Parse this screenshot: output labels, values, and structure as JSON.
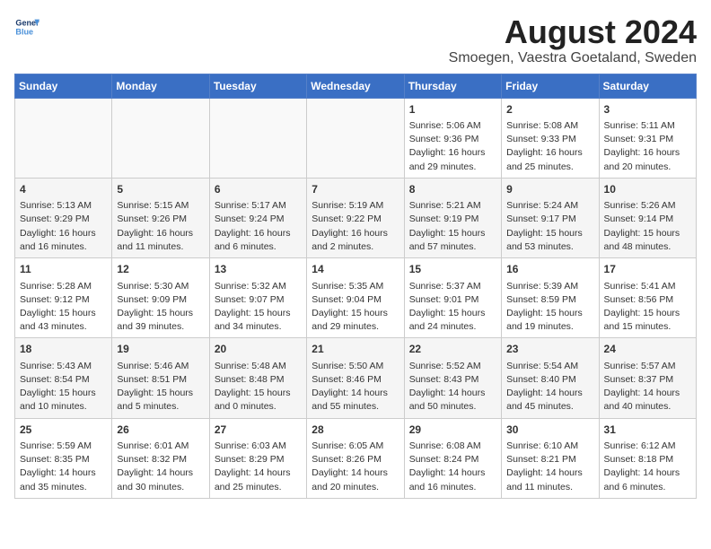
{
  "logo": {
    "line1": "General",
    "line2": "Blue"
  },
  "title": "August 2024",
  "subtitle": "Smoegen, Vaestra Goetaland, Sweden",
  "days_of_week": [
    "Sunday",
    "Monday",
    "Tuesday",
    "Wednesday",
    "Thursday",
    "Friday",
    "Saturday"
  ],
  "weeks": [
    [
      {
        "day": "",
        "info": ""
      },
      {
        "day": "",
        "info": ""
      },
      {
        "day": "",
        "info": ""
      },
      {
        "day": "",
        "info": ""
      },
      {
        "day": "1",
        "info": "Sunrise: 5:06 AM\nSunset: 9:36 PM\nDaylight: 16 hours\nand 29 minutes."
      },
      {
        "day": "2",
        "info": "Sunrise: 5:08 AM\nSunset: 9:33 PM\nDaylight: 16 hours\nand 25 minutes."
      },
      {
        "day": "3",
        "info": "Sunrise: 5:11 AM\nSunset: 9:31 PM\nDaylight: 16 hours\nand 20 minutes."
      }
    ],
    [
      {
        "day": "4",
        "info": "Sunrise: 5:13 AM\nSunset: 9:29 PM\nDaylight: 16 hours\nand 16 minutes."
      },
      {
        "day": "5",
        "info": "Sunrise: 5:15 AM\nSunset: 9:26 PM\nDaylight: 16 hours\nand 11 minutes."
      },
      {
        "day": "6",
        "info": "Sunrise: 5:17 AM\nSunset: 9:24 PM\nDaylight: 16 hours\nand 6 minutes."
      },
      {
        "day": "7",
        "info": "Sunrise: 5:19 AM\nSunset: 9:22 PM\nDaylight: 16 hours\nand 2 minutes."
      },
      {
        "day": "8",
        "info": "Sunrise: 5:21 AM\nSunset: 9:19 PM\nDaylight: 15 hours\nand 57 minutes."
      },
      {
        "day": "9",
        "info": "Sunrise: 5:24 AM\nSunset: 9:17 PM\nDaylight: 15 hours\nand 53 minutes."
      },
      {
        "day": "10",
        "info": "Sunrise: 5:26 AM\nSunset: 9:14 PM\nDaylight: 15 hours\nand 48 minutes."
      }
    ],
    [
      {
        "day": "11",
        "info": "Sunrise: 5:28 AM\nSunset: 9:12 PM\nDaylight: 15 hours\nand 43 minutes."
      },
      {
        "day": "12",
        "info": "Sunrise: 5:30 AM\nSunset: 9:09 PM\nDaylight: 15 hours\nand 39 minutes."
      },
      {
        "day": "13",
        "info": "Sunrise: 5:32 AM\nSunset: 9:07 PM\nDaylight: 15 hours\nand 34 minutes."
      },
      {
        "day": "14",
        "info": "Sunrise: 5:35 AM\nSunset: 9:04 PM\nDaylight: 15 hours\nand 29 minutes."
      },
      {
        "day": "15",
        "info": "Sunrise: 5:37 AM\nSunset: 9:01 PM\nDaylight: 15 hours\nand 24 minutes."
      },
      {
        "day": "16",
        "info": "Sunrise: 5:39 AM\nSunset: 8:59 PM\nDaylight: 15 hours\nand 19 minutes."
      },
      {
        "day": "17",
        "info": "Sunrise: 5:41 AM\nSunset: 8:56 PM\nDaylight: 15 hours\nand 15 minutes."
      }
    ],
    [
      {
        "day": "18",
        "info": "Sunrise: 5:43 AM\nSunset: 8:54 PM\nDaylight: 15 hours\nand 10 minutes."
      },
      {
        "day": "19",
        "info": "Sunrise: 5:46 AM\nSunset: 8:51 PM\nDaylight: 15 hours\nand 5 minutes."
      },
      {
        "day": "20",
        "info": "Sunrise: 5:48 AM\nSunset: 8:48 PM\nDaylight: 15 hours\nand 0 minutes."
      },
      {
        "day": "21",
        "info": "Sunrise: 5:50 AM\nSunset: 8:46 PM\nDaylight: 14 hours\nand 55 minutes."
      },
      {
        "day": "22",
        "info": "Sunrise: 5:52 AM\nSunset: 8:43 PM\nDaylight: 14 hours\nand 50 minutes."
      },
      {
        "day": "23",
        "info": "Sunrise: 5:54 AM\nSunset: 8:40 PM\nDaylight: 14 hours\nand 45 minutes."
      },
      {
        "day": "24",
        "info": "Sunrise: 5:57 AM\nSunset: 8:37 PM\nDaylight: 14 hours\nand 40 minutes."
      }
    ],
    [
      {
        "day": "25",
        "info": "Sunrise: 5:59 AM\nSunset: 8:35 PM\nDaylight: 14 hours\nand 35 minutes."
      },
      {
        "day": "26",
        "info": "Sunrise: 6:01 AM\nSunset: 8:32 PM\nDaylight: 14 hours\nand 30 minutes."
      },
      {
        "day": "27",
        "info": "Sunrise: 6:03 AM\nSunset: 8:29 PM\nDaylight: 14 hours\nand 25 minutes."
      },
      {
        "day": "28",
        "info": "Sunrise: 6:05 AM\nSunset: 8:26 PM\nDaylight: 14 hours\nand 20 minutes."
      },
      {
        "day": "29",
        "info": "Sunrise: 6:08 AM\nSunset: 8:24 PM\nDaylight: 14 hours\nand 16 minutes."
      },
      {
        "day": "30",
        "info": "Sunrise: 6:10 AM\nSunset: 8:21 PM\nDaylight: 14 hours\nand 11 minutes."
      },
      {
        "day": "31",
        "info": "Sunrise: 6:12 AM\nSunset: 8:18 PM\nDaylight: 14 hours\nand 6 minutes."
      }
    ]
  ]
}
